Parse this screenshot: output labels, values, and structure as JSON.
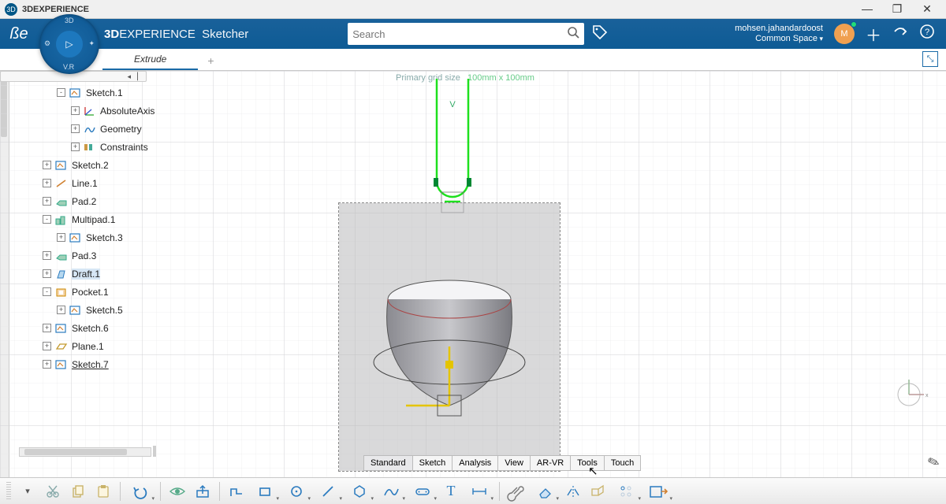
{
  "app": {
    "title": "3DEXPERIENCE"
  },
  "header": {
    "brand_bold": "3D",
    "brand_light": "EXPERIENCE",
    "module": "Sketcher",
    "search_placeholder": "Search",
    "user_name": "mohsen.jahandardoost",
    "space_label": "Common Space",
    "avatar_initial": "M"
  },
  "compass": {
    "center": "▷",
    "n": "3D",
    "s": "V.R",
    "w": "⚙",
    "e": "✦"
  },
  "tabbar": {
    "tab": "Extrude",
    "plus": "+"
  },
  "tree": [
    {
      "level": 1,
      "exp": "-",
      "name": "Sketch.1",
      "icon": "sketch",
      "hl": false
    },
    {
      "level": 2,
      "exp": "+",
      "name": "AbsoluteAxis",
      "icon": "axis",
      "hl": false
    },
    {
      "level": 2,
      "exp": "+",
      "name": "Geometry",
      "icon": "geometry",
      "hl": false
    },
    {
      "level": 2,
      "exp": "+",
      "name": "Constraints",
      "icon": "constraint",
      "hl": false
    },
    {
      "level": 0,
      "exp": "+",
      "name": "Sketch.2",
      "icon": "sketch",
      "hl": false
    },
    {
      "level": 0,
      "exp": "+",
      "name": "Line.1",
      "icon": "line",
      "hl": false
    },
    {
      "level": 0,
      "exp": "+",
      "name": "Pad.2",
      "icon": "pad",
      "hl": false
    },
    {
      "level": 0,
      "exp": "-",
      "name": "Multipad.1",
      "icon": "multipad",
      "hl": false
    },
    {
      "level": 1,
      "exp": "+",
      "name": "Sketch.3",
      "icon": "sketch",
      "hl": false
    },
    {
      "level": 0,
      "exp": "+",
      "name": "Pad.3",
      "icon": "pad",
      "hl": false
    },
    {
      "level": 0,
      "exp": "+",
      "name": "Draft.1",
      "icon": "draft",
      "hl": true
    },
    {
      "level": 0,
      "exp": "-",
      "name": "Pocket.1",
      "icon": "pocket",
      "hl": false
    },
    {
      "level": 1,
      "exp": "+",
      "name": "Sketch.5",
      "icon": "sketch",
      "hl": false
    },
    {
      "level": 0,
      "exp": "+",
      "name": "Sketch.6",
      "icon": "sketch",
      "hl": false
    },
    {
      "level": 0,
      "exp": "+",
      "name": "Plane.1",
      "icon": "plane",
      "hl": false
    },
    {
      "level": 0,
      "exp": "+",
      "name": "Sketch.7",
      "icon": "sketch",
      "hl": false,
      "ul": true
    }
  ],
  "canvas": {
    "grid_label": "Primary grid size",
    "grid_value": "100mm x 100mm",
    "axis_label": "V"
  },
  "section_tabs": [
    "Standard",
    "Sketch",
    "Analysis",
    "View",
    "AR-VR",
    "Tools",
    "Touch"
  ],
  "section_active": "Standard",
  "toolbar_drop": "▾"
}
